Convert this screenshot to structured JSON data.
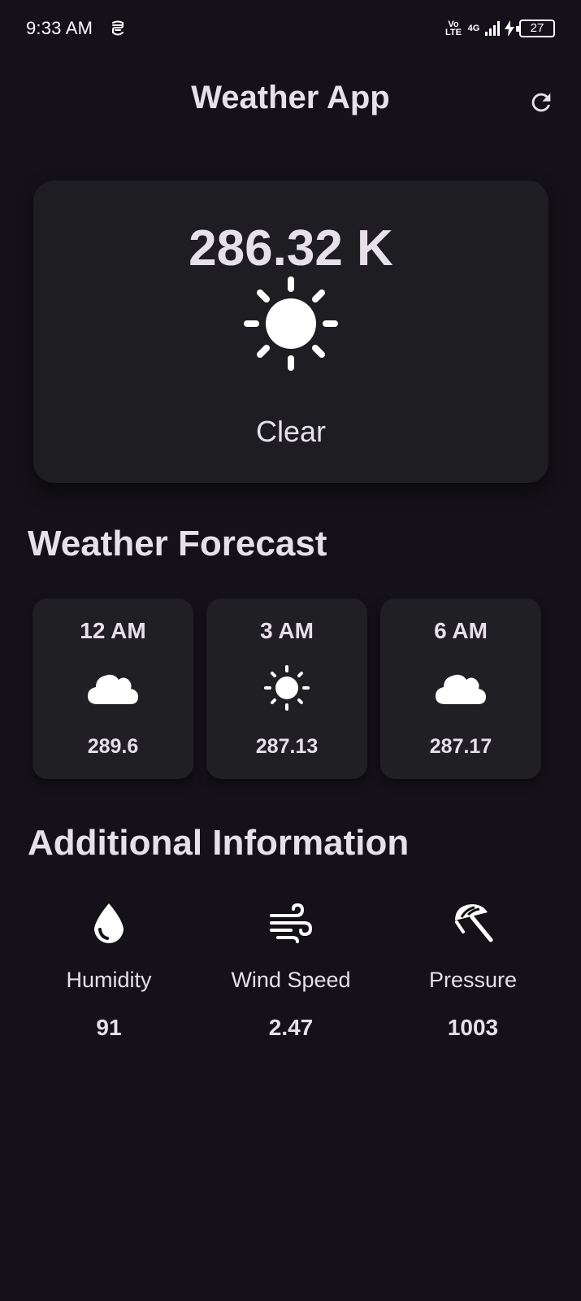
{
  "status_bar": {
    "time": "9:33 AM",
    "volte_top": "Vo",
    "volte_bottom": "LTE",
    "network": "4G",
    "battery": "27"
  },
  "app_bar": {
    "title": "Weather App",
    "refresh_icon": "refresh-icon"
  },
  "current": {
    "temperature": "286.32 K",
    "icon": "sun-icon",
    "description": "Clear"
  },
  "forecast": {
    "title": "Weather Forecast",
    "items": [
      {
        "time": "12 AM",
        "icon": "cloud-icon",
        "temp": "289.6"
      },
      {
        "time": "3 AM",
        "icon": "sun-icon",
        "temp": "287.13"
      },
      {
        "time": "6 AM",
        "icon": "cloud-icon",
        "temp": "287.17"
      }
    ]
  },
  "additional": {
    "title": "Additional Information",
    "items": [
      {
        "label": "Humidity",
        "icon": "water-drop-icon",
        "value": "91"
      },
      {
        "label": "Wind Speed",
        "icon": "wind-icon",
        "value": "2.47"
      },
      {
        "label": "Pressure",
        "icon": "beach-umbrella-icon",
        "value": "1003"
      }
    ]
  },
  "colors": {
    "background": "#141218",
    "card": "#1e1d22",
    "text": "#e6e0e9"
  }
}
